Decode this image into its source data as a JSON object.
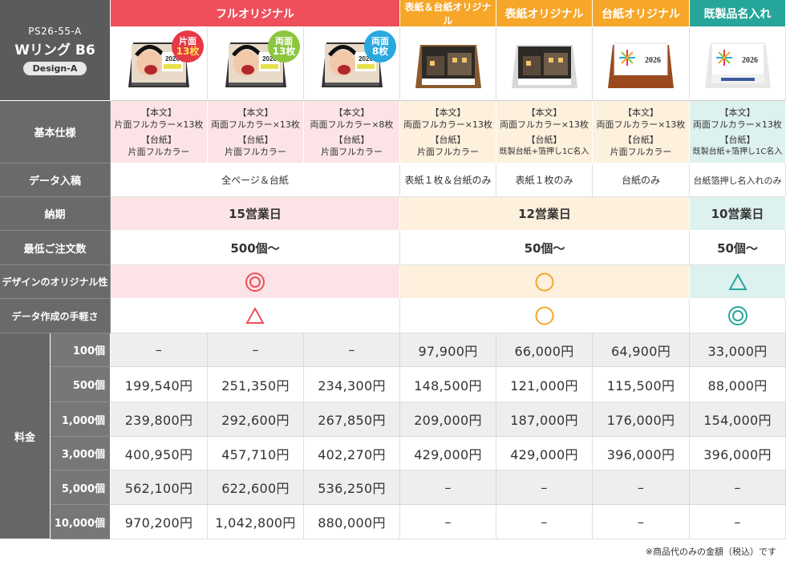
{
  "product": {
    "code": "PS26-55-A",
    "name": "Wリング B6",
    "design": "Design-A"
  },
  "headers": {
    "full_original": "フルオリジナル",
    "cover_and_stand": "表紙＆台紙オリジナル",
    "cover_original": "表紙オリジナル",
    "stand_original": "台紙オリジナル",
    "ready_made": "既製品名入れ"
  },
  "badges": [
    {
      "top": "片面",
      "count": "13枚"
    },
    {
      "top": "両面",
      "count": "13枚"
    },
    {
      "top": "両面",
      "count": "8枚"
    }
  ],
  "thumb_year": "2026",
  "rows": {
    "spec": "基本仕様",
    "data_submit": "データ入稿",
    "delivery": "納期",
    "min_order": "最低ご注文数",
    "design_originality": "デザインのオリジナル性",
    "ease_of_data": "データ作成の手軽さ",
    "price": "料金"
  },
  "spec": [
    {
      "honbun": "【本文】",
      "honbun_val": "片面フルカラー×13枚",
      "daishi": "【台紙】",
      "daishi_val": "片面フルカラー"
    },
    {
      "honbun": "【本文】",
      "honbun_val": "両面フルカラー×13枚",
      "daishi": "【台紙】",
      "daishi_val": "片面フルカラー"
    },
    {
      "honbun": "【本文】",
      "honbun_val": "両面フルカラー×8枚",
      "daishi": "【台紙】",
      "daishi_val": "片面フルカラー"
    },
    {
      "honbun": "【本文】",
      "honbun_val": "両面フルカラー×13枚",
      "daishi": "【台紙】",
      "daishi_val": "片面フルカラー"
    },
    {
      "honbun": "【本文】",
      "honbun_val": "両面フルカラー×13枚",
      "daishi": "【台紙】",
      "daishi_val": "既製台紙+箔押し1C名入"
    },
    {
      "honbun": "【本文】",
      "honbun_val": "両面フルカラー×13枚",
      "daishi": "【台紙】",
      "daishi_val": "片面フルカラー"
    },
    {
      "honbun": "【本文】",
      "honbun_val": "両面フルカラー×13枚",
      "daishi": "【台紙】",
      "daishi_val": "既製台紙+箔押し1C名入"
    }
  ],
  "data_submit": [
    "全ページ＆台紙",
    "表紙１枚＆台紙のみ",
    "表紙１枚のみ",
    "台紙のみ",
    "台紙箔押し名入れのみ"
  ],
  "delivery": [
    "15営業日",
    "12営業日",
    "10営業日"
  ],
  "min_order": [
    "500個〜",
    "50個〜",
    "50個〜"
  ],
  "marks": {
    "originality": [
      "double-circle",
      "circle",
      "triangle"
    ],
    "ease": [
      "triangle",
      "circle",
      "double-circle"
    ],
    "colors": {
      "red": "#ee4f5a",
      "orange": "#f6a628",
      "teal": "#26a69a"
    }
  },
  "quantities": [
    "100個",
    "500個",
    "1,000個",
    "3,000個",
    "5,000個",
    "10,000個"
  ],
  "prices": [
    [
      "–",
      "–",
      "–",
      "97,900円",
      "66,000円",
      "64,900円",
      "33,000円"
    ],
    [
      "199,540円",
      "251,350円",
      "234,300円",
      "148,500円",
      "121,000円",
      "115,500円",
      "88,000円"
    ],
    [
      "239,800円",
      "292,600円",
      "267,850円",
      "209,000円",
      "187,000円",
      "176,000円",
      "154,000円"
    ],
    [
      "400,950円",
      "457,710円",
      "402,270円",
      "429,000円",
      "429,000円",
      "396,000円",
      "396,000円"
    ],
    [
      "562,100円",
      "622,600円",
      "536,250円",
      "–",
      "–",
      "–",
      "–"
    ],
    [
      "970,200円",
      "1,042,800円",
      "880,000円",
      "–",
      "–",
      "–",
      "–"
    ]
  ],
  "footnote": "※商品代のみの金額（税込）です"
}
